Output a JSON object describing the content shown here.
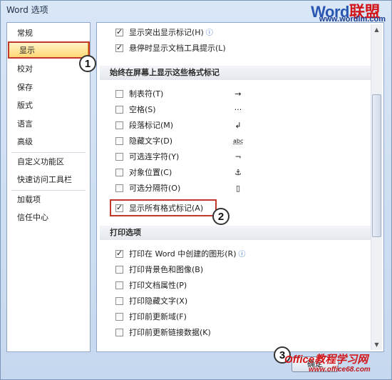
{
  "window": {
    "title": "Word 选项"
  },
  "watermark": {
    "top_brand_word": "Word",
    "top_brand_cn": "联盟",
    "top_url": "www.wordlm.com",
    "bottom_brand": "Office教程学习网",
    "bottom_url": "www.office68.com"
  },
  "nav": {
    "items": [
      "常规",
      "显示",
      "校对",
      "保存",
      "版式",
      "语言",
      "高级",
      "自定义功能区",
      "快速访问工具栏",
      "加载项",
      "信任中心"
    ],
    "active_index": 1
  },
  "top_options": [
    {
      "label": "显示突出显示标记(H)",
      "checked": true,
      "info": true
    },
    {
      "label": "悬停时显示文档工具提示(L)",
      "checked": true,
      "info": false
    }
  ],
  "format_marks": {
    "header": "始终在屏幕上显示这些格式标记",
    "options": [
      {
        "label": "制表符(T)",
        "checked": false,
        "symbol": "→"
      },
      {
        "label": "空格(S)",
        "checked": false,
        "symbol": "···"
      },
      {
        "label": "段落标记(M)",
        "checked": false,
        "symbol": "↲"
      },
      {
        "label": "隐藏文字(D)",
        "checked": false,
        "symbol": "abc"
      },
      {
        "label": "可选连字符(Y)",
        "checked": false,
        "symbol": "¬"
      },
      {
        "label": "对象位置(C)",
        "checked": false,
        "symbol": "⚓"
      },
      {
        "label": "可选分隔符(O)",
        "checked": false,
        "symbol": "▯"
      },
      {
        "label": "显示所有格式标记(A)",
        "checked": true,
        "symbol": ""
      }
    ]
  },
  "print": {
    "header": "打印选项",
    "options": [
      {
        "label": "打印在 Word 中创建的图形(R)",
        "checked": true,
        "info": true
      },
      {
        "label": "打印背景色和图像(B)",
        "checked": false,
        "info": false
      },
      {
        "label": "打印文档属性(P)",
        "checked": false,
        "info": false
      },
      {
        "label": "打印隐藏文字(X)",
        "checked": false,
        "info": false
      },
      {
        "label": "打印前更新域(F)",
        "checked": false,
        "info": false
      },
      {
        "label": "打印前更新链接数据(K)",
        "checked": false,
        "info": false
      }
    ]
  },
  "callouts": [
    "1",
    "2",
    "3"
  ],
  "buttons": {
    "ok_label": "确定"
  },
  "icons": {
    "info": "info-icon",
    "scroll_up": "scroll-up-icon",
    "scroll_down": "scroll-down-icon"
  }
}
